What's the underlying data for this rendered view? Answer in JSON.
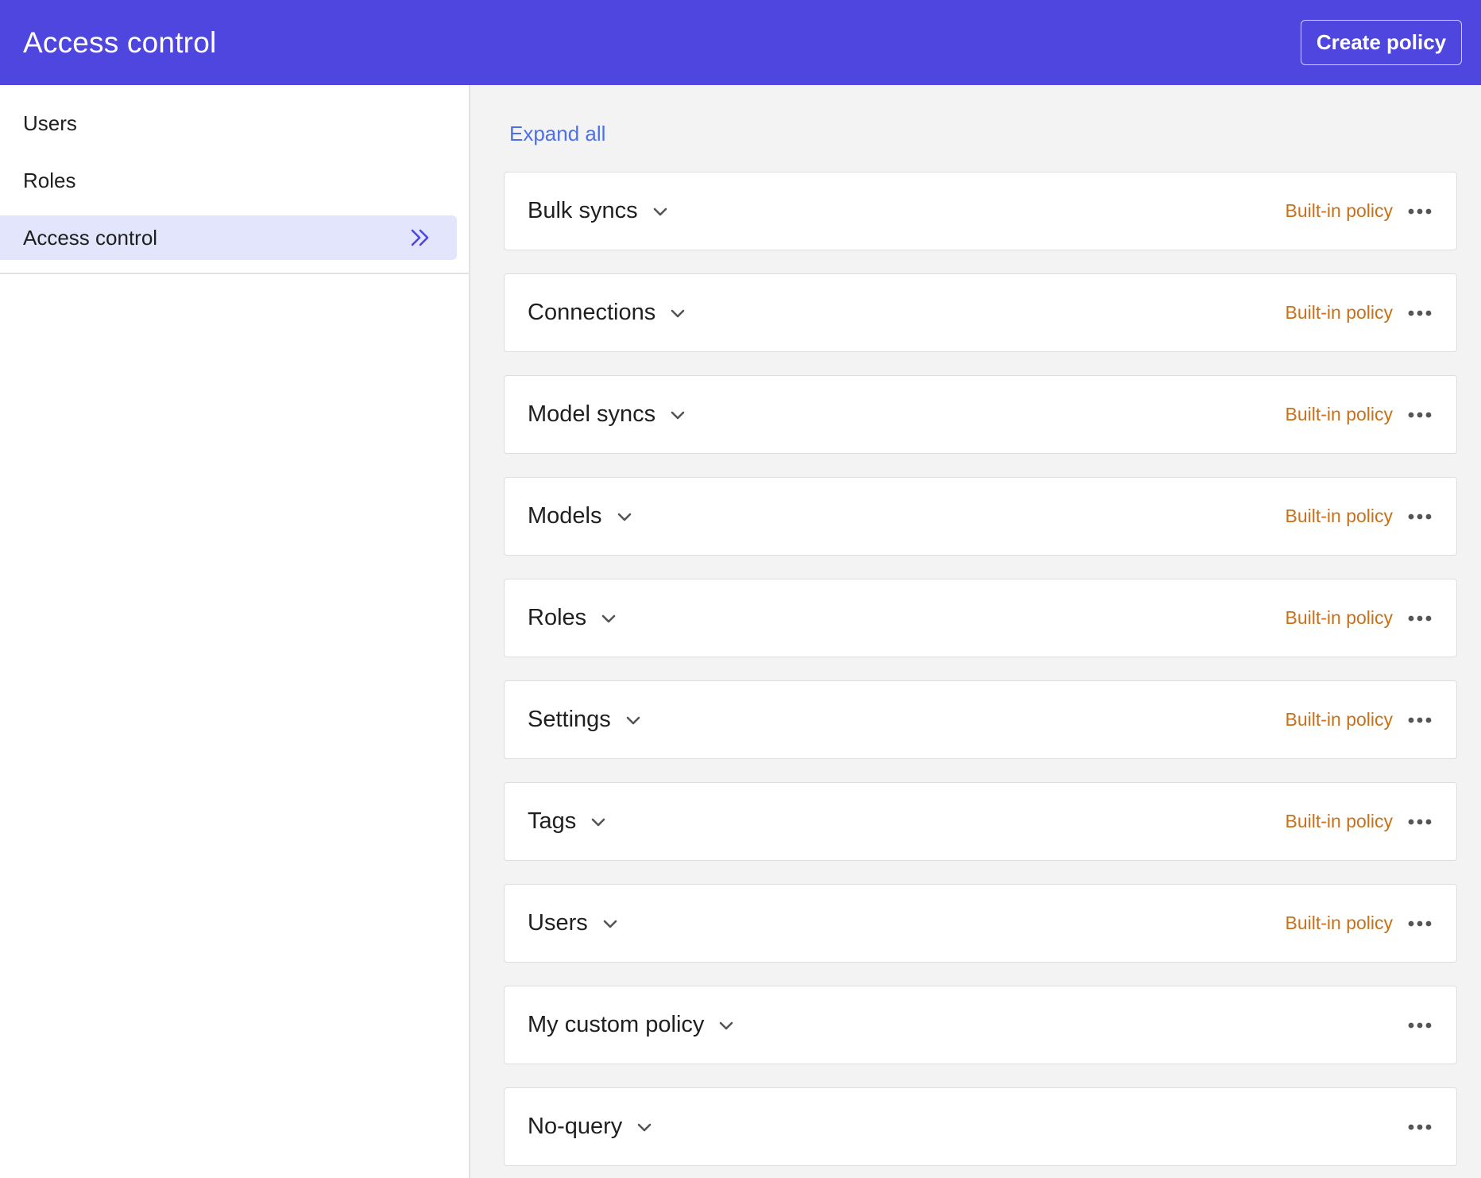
{
  "header": {
    "title": "Access control",
    "create_label": "Create policy"
  },
  "sidebar": {
    "items": [
      {
        "label": "Users"
      },
      {
        "label": "Roles"
      },
      {
        "label": "Access control",
        "active": true,
        "icon": "double-chevron-right-icon"
      }
    ]
  },
  "main": {
    "expand_all_label": "Expand all",
    "policies": [
      {
        "name": "Bulk syncs",
        "badge": "Built-in policy"
      },
      {
        "name": "Connections",
        "badge": "Built-in policy"
      },
      {
        "name": "Model syncs",
        "badge": "Built-in policy"
      },
      {
        "name": "Models",
        "badge": "Built-in policy"
      },
      {
        "name": "Roles",
        "badge": "Built-in policy"
      },
      {
        "name": "Settings",
        "badge": "Built-in policy"
      },
      {
        "name": "Tags",
        "badge": "Built-in policy"
      },
      {
        "name": "Users",
        "badge": "Built-in policy"
      },
      {
        "name": "My custom policy",
        "badge": ""
      },
      {
        "name": "No-query",
        "badge": ""
      }
    ]
  },
  "colors": {
    "header_bg": "#4f46e0",
    "active_nav_bg": "#e2e5fb",
    "link": "#4f6fe8",
    "badge": "#c9701a"
  }
}
